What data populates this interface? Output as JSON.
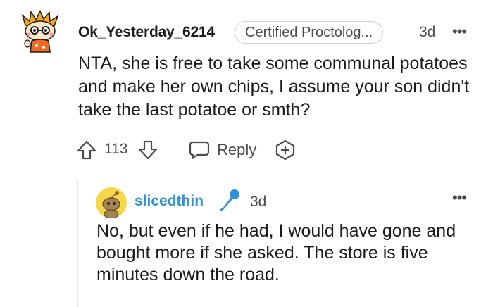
{
  "comment": {
    "username": "Ok_Yesterday_6214",
    "flair": "Certified Proctolog...",
    "timestamp": "3d",
    "more_label": "•••",
    "body": "NTA, she is free to take some communal potatoes and make her own chips, I assume your son didn't take the last potatoe or smth?",
    "vote_count": "113",
    "reply_label": "Reply",
    "avatar_icon": "snoo-avatar-icon",
    "upvote_icon": "upvote-arrow-icon",
    "downvote_icon": "downvote-arrow-icon",
    "reply_icon": "speech-bubble-icon",
    "award_icon": "award-plus-icon"
  },
  "reply": {
    "username": "slicedthin",
    "timestamp": "3d",
    "more_label": "•••",
    "body": "No, but even if he had, I would have gone and bought more if she asked. The store is five minutes down the road.",
    "op_icon": "microphone-icon",
    "avatar_icon": "snoo-avatar-icon"
  },
  "colors": {
    "username_op": "#2f93d8",
    "text_primary": "#1c1c1c",
    "text_secondary": "#4a4d50",
    "thread_line": "#e4e6e8",
    "flair_border": "#cfd2d4"
  }
}
